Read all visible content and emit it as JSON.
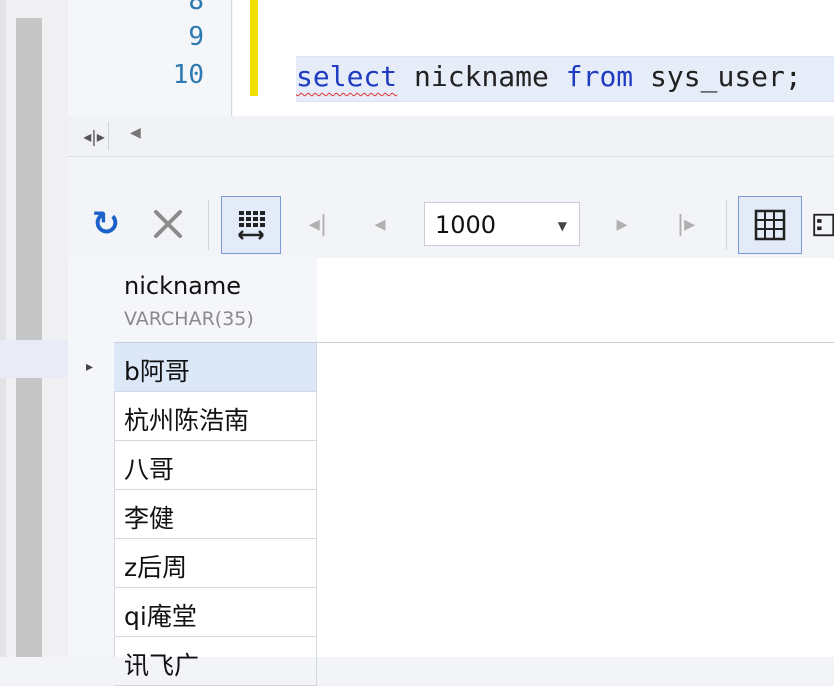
{
  "editor": {
    "line_numbers": [
      "8",
      "9",
      "10"
    ],
    "code": {
      "keyword_select": "select",
      "column": "nickname",
      "keyword_from": "from",
      "table": "sys_user;"
    }
  },
  "toolbar": {
    "refresh_icon": "refresh-icon",
    "cancel_icon": "cancel-icon",
    "row_limit": "1000"
  },
  "grid": {
    "column": {
      "name": "nickname",
      "type": "VARCHAR(35)"
    },
    "rows": [
      "b阿哥",
      "杭州陈浩南",
      "八哥",
      "李健",
      "z后周",
      "qi庵堂",
      "讯飞广"
    ]
  },
  "colors": {
    "keyword": "#1f3cc2",
    "line_number": "#2b7ab0",
    "change_marker": "#f0e000",
    "selected_row": "#dce7f7",
    "refresh": "#1c62c8"
  }
}
